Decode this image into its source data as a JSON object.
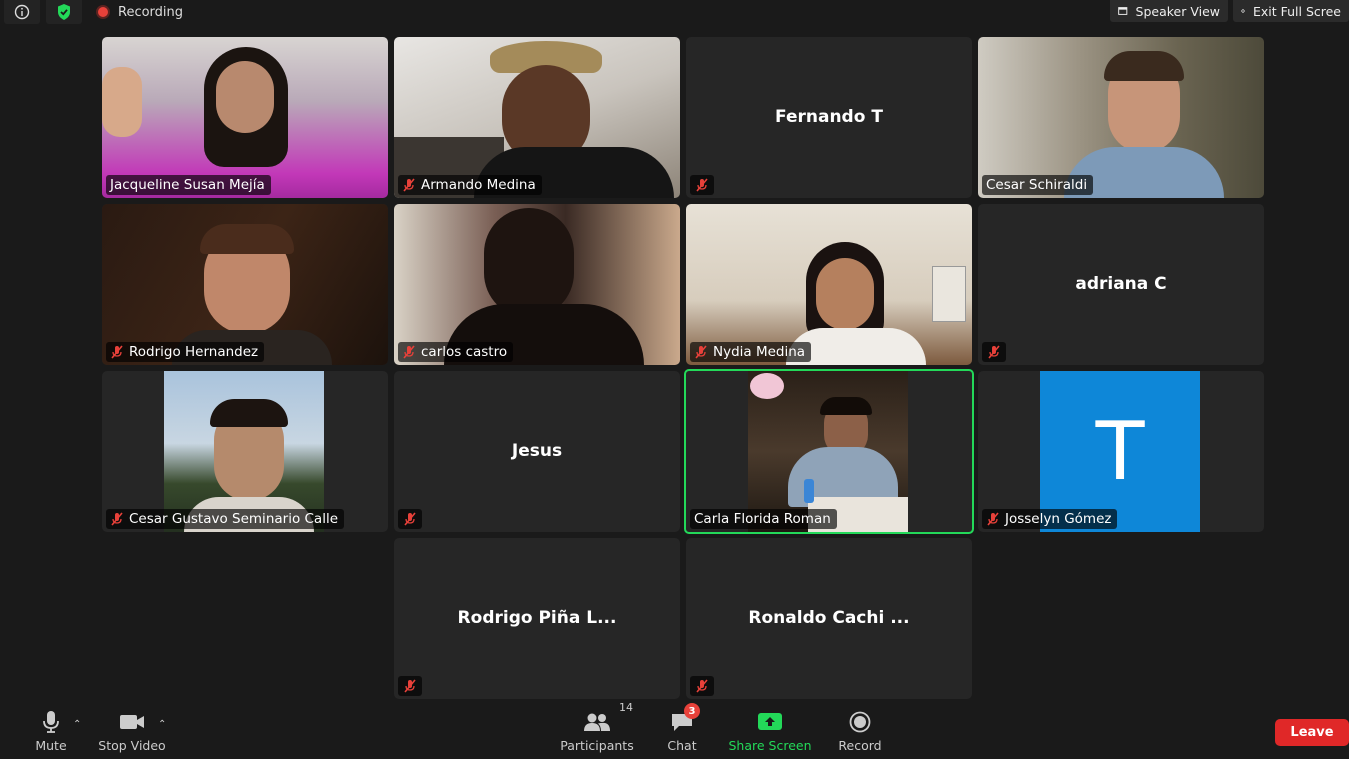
{
  "topbar": {
    "recording_label": "Recording",
    "speaker_view_label": "Speaker View",
    "exit_fullscreen_label": "Exit Full Scree"
  },
  "tiles": [
    {
      "name": "Jacqueline Susan Mejía",
      "video": true,
      "muted": false
    },
    {
      "name": "Armando Medina",
      "video": true,
      "muted": true
    },
    {
      "name": "Fernando T",
      "video": false,
      "muted": true
    },
    {
      "name": "Cesar Schiraldi",
      "video": true,
      "muted": false
    },
    {
      "name": "Rodrigo Hernandez",
      "video": true,
      "muted": true
    },
    {
      "name": "carlos castro",
      "video": true,
      "muted": true
    },
    {
      "name": "Nydia Medina",
      "video": true,
      "muted": true
    },
    {
      "name": "adriana C",
      "video": false,
      "muted": true
    },
    {
      "name": "Cesar Gustavo Seminario Calle",
      "video": true,
      "muted": true
    },
    {
      "name": "Jesus",
      "video": false,
      "muted": true
    },
    {
      "name": "Carla Florida Roman",
      "video": true,
      "muted": false,
      "active_speaker": true
    },
    {
      "name": "Josselyn Gómez",
      "video": false,
      "avatar_letter": "T",
      "muted": true
    },
    {
      "name": "Rodrigo Piña L...",
      "video": false,
      "muted": true
    },
    {
      "name": "Ronaldo Cachi ...",
      "video": false,
      "muted": true
    }
  ],
  "toolbar": {
    "mute_label": "Mute",
    "stop_video_label": "Stop Video",
    "participants_label": "Participants",
    "participants_count": "14",
    "chat_label": "Chat",
    "chat_badge": "3",
    "share_screen_label": "Share Screen",
    "record_label": "Record",
    "leave_label": "Leave"
  },
  "colors": {
    "active_speaker_border": "#23d959",
    "share_screen": "#23d959",
    "leave_button": "#e02828",
    "avatar_bg": "#0e87d8",
    "muted_icon": "#e8413a"
  }
}
